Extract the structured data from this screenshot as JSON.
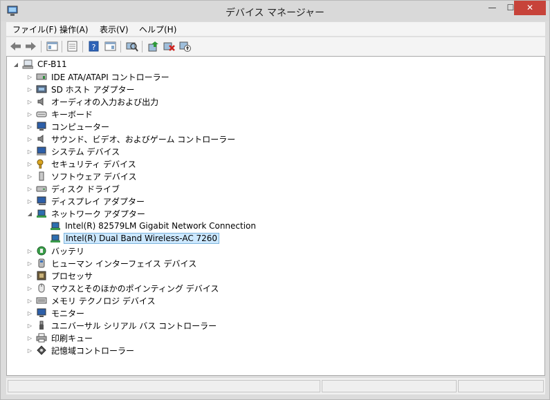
{
  "window": {
    "title": "デバイス マネージャー"
  },
  "menu": [
    "ファイル(F)",
    "操作(A)",
    "表示(V)",
    "ヘルプ(H)"
  ],
  "toolbar": {
    "buttons": [
      "back-arrow-icon",
      "forward-arrow-icon",
      "show-hide-console-tree-icon",
      "properties-icon",
      "help-icon",
      "action-pane-icon",
      "scan-hardware-icon",
      "update-driver-icon",
      "uninstall-icon",
      "disable-device-icon"
    ]
  },
  "tree": {
    "root": "CF-B11",
    "items": [
      "IDE ATA/ATAPI コントローラー",
      "SD ホスト アダプター",
      "オーディオの入力および出力",
      "キーボード",
      "コンピューター",
      "サウンド、ビデオ、およびゲーム コントローラー",
      "システム デバイス",
      "セキュリティ デバイス",
      "ソフトウェア デバイス",
      "ディスク ドライブ",
      "ディスプレイ アダプター",
      "ネットワーク アダプター",
      "Intel(R) 82579LM Gigabit Network Connection",
      "Intel(R) Dual Band Wireless-AC 7260",
      "バッテリ",
      "ヒューマン インターフェイス デバイス",
      "プロセッサ",
      "マウスとそのほかのポインティング デバイス",
      "メモリ テクノロジ デバイス",
      "モニター",
      "ユニバーサル シリアル バス コントローラー",
      "印刷キュー",
      "記憶域コントローラー"
    ]
  },
  "colors": {
    "selection_bg": "#cce8ff",
    "selection_border": "#7db4dc",
    "close_button": "#c7433a"
  }
}
